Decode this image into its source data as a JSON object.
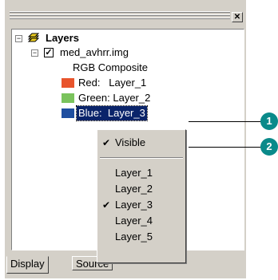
{
  "toc": {
    "root_label": "Layers",
    "layer_name": "med_avhrr.img",
    "composite_label": "RGB Composite",
    "bands": [
      {
        "label": "Red:   Layer_1",
        "color": "#e8542c"
      },
      {
        "label": "Green: Layer_2",
        "color": "#7ac35c"
      },
      {
        "label": "Blue:  Layer_3",
        "color": "#1f4fa0"
      }
    ]
  },
  "context_menu": {
    "visible_label": "Visible",
    "items": [
      "Layer_1",
      "Layer_2",
      "Layer_3",
      "Layer_4",
      "Layer_5"
    ],
    "checked_item": "Layer_3"
  },
  "tabs": [
    "Display",
    "Source"
  ],
  "callouts": [
    "1",
    "2"
  ],
  "colors": {
    "callout": "#0a8a8a",
    "selection": "#0a246a"
  }
}
